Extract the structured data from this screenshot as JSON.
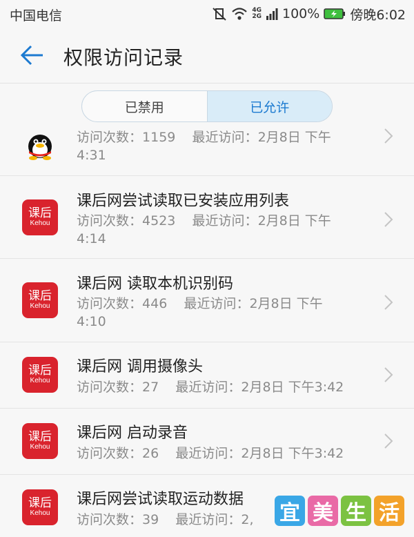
{
  "status_bar": {
    "carrier": "中国电信",
    "net_top": "4G",
    "net_bottom": "2G",
    "battery": "100%",
    "time": "傍晚6:02"
  },
  "app_bar": {
    "title": "权限访问记录"
  },
  "tabs": [
    {
      "label": "已禁用",
      "active": false
    },
    {
      "label": "已允许",
      "active": true
    }
  ],
  "labels": {
    "count_prefix": "访问次数：",
    "recent_prefix": "最近访问："
  },
  "app_icon": {
    "cn": "课后",
    "en": "Kehou"
  },
  "rows": [
    {
      "title": "",
      "count": "1159",
      "date": "2月8日 下午",
      "time": "4:31",
      "icon": "qq-penguin"
    },
    {
      "title": "课后网尝试读取已安装应用列表",
      "count": "4523",
      "date": "2月8日 下午",
      "time": "4:14",
      "icon": "kehou"
    },
    {
      "title": "课后网 读取本机识别码",
      "count": "446",
      "date": "2月8日 下午",
      "time": "4:10",
      "icon": "kehou"
    },
    {
      "title": "课后网 调用摄像头",
      "count": "27",
      "date": "2月8日 下午3:42",
      "time": "",
      "icon": "kehou"
    },
    {
      "title": "课后网 启动录音",
      "count": "26",
      "date": "2月8日 下午3:42",
      "time": "",
      "icon": "kehou"
    },
    {
      "title": "课后网尝试读取运动数据",
      "count": "39",
      "date": "2,",
      "time": "",
      "icon": "kehou"
    }
  ],
  "watermark": [
    {
      "char": "宜",
      "color": "#3aa7e6"
    },
    {
      "char": "美",
      "color": "#e96aa6"
    },
    {
      "char": "生",
      "color": "#7cc242"
    },
    {
      "char": "活",
      "color": "#f3a22a"
    }
  ],
  "colors": {
    "accent": "#1c7ad0",
    "app_red": "#d9232d"
  }
}
